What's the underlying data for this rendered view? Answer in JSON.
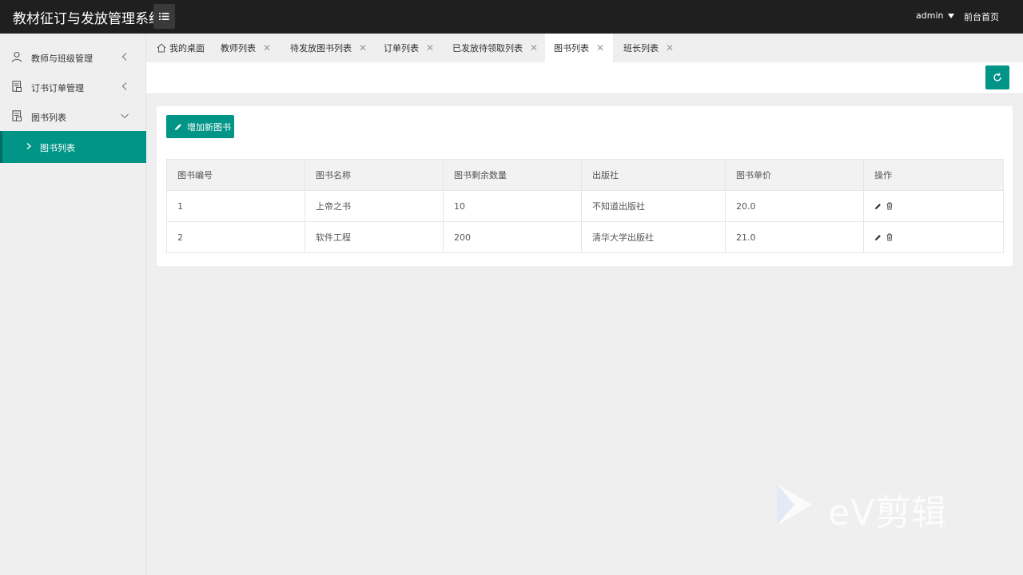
{
  "app": {
    "title": "教材征订与发放管理系统"
  },
  "header": {
    "user": "admin",
    "front_link": "前台首页"
  },
  "sidebar": {
    "items": [
      {
        "label": "教师与班级管理"
      },
      {
        "label": "订书订单管理"
      },
      {
        "label": "图书列表"
      }
    ],
    "sub_item": {
      "label": "图书列表"
    }
  },
  "tabs": [
    {
      "label": "我的桌面"
    },
    {
      "label": "教师列表"
    },
    {
      "label": "待发放图书列表"
    },
    {
      "label": "订单列表"
    },
    {
      "label": "已发放待领取列表"
    },
    {
      "label": "图书列表"
    },
    {
      "label": "班长列表"
    }
  ],
  "actions": {
    "add_book": "增加新图书"
  },
  "table": {
    "headers": [
      "图书编号",
      "图书名称",
      "图书剩余数量",
      "出版社",
      "图书单价",
      "操作"
    ],
    "rows": [
      [
        "1",
        "上帝之书",
        "10",
        "不知道出版社",
        "20.0"
      ],
      [
        "2",
        "软件工程",
        "200",
        "清华大学出版社",
        "21.0"
      ]
    ]
  },
  "watermark": {
    "text": "eV剪辑"
  },
  "colors": {
    "accent": "#009587",
    "header_bg": "#1f1f1f"
  }
}
